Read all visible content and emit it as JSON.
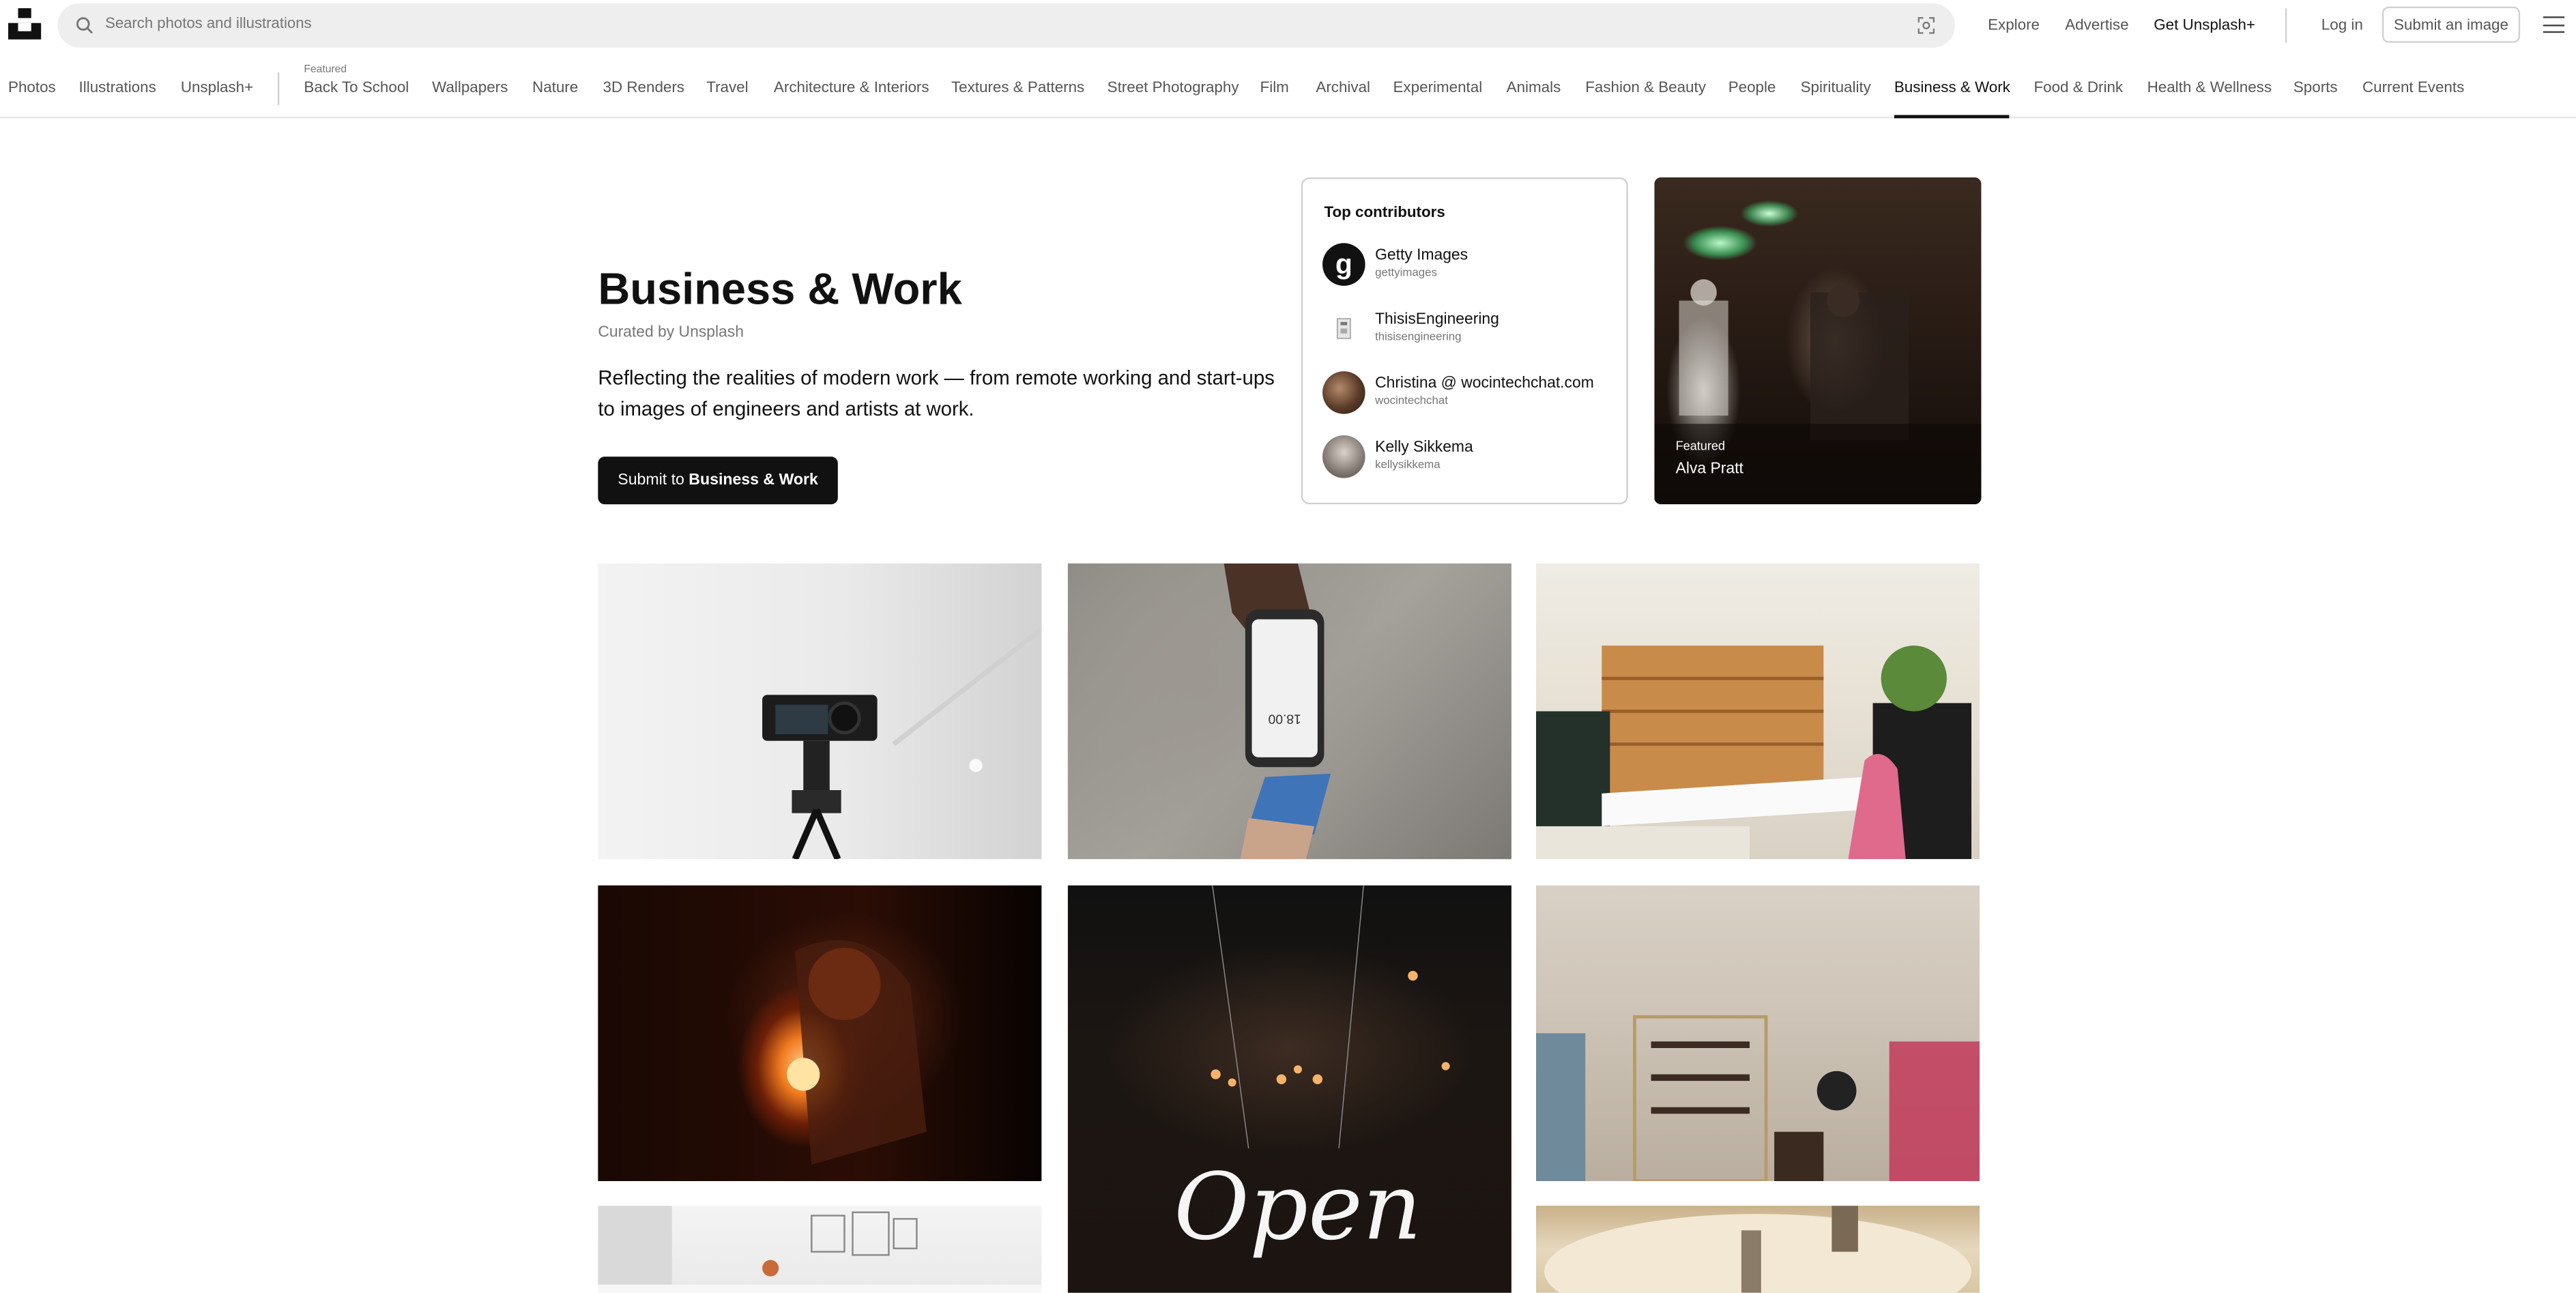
{
  "header": {
    "search_placeholder": "Search photos and illustrations",
    "links": {
      "explore": "Explore",
      "advertise": "Advertise",
      "get_plus": "Get Unsplash+",
      "login": "Log in",
      "submit_image": "Submit an image"
    }
  },
  "categories": {
    "items": [
      "Photos",
      "Illustrations",
      "Unsplash+",
      "Back To School",
      "Wallpapers",
      "Nature",
      "3D Renders",
      "Travel",
      "Architecture & Interiors",
      "Textures & Patterns",
      "Street Photography",
      "Film",
      "Archival",
      "Experimental",
      "Animals",
      "Fashion & Beauty",
      "People",
      "Spirituality",
      "Business & Work",
      "Food & Drink",
      "Health & Wellness",
      "Sports",
      "Current Events"
    ],
    "featured_label": "Featured",
    "active": "Business & Work"
  },
  "hero": {
    "title": "Business & Work",
    "curated": "Curated by Unsplash",
    "description": "Reflecting the realities of modern work — from remote working and start-ups to images of engineers and artists at work.",
    "submit_prefix": "Submit to",
    "submit_topic": "Business & Work"
  },
  "contributors": {
    "title": "Top contributors",
    "items": [
      {
        "name": "Getty Images",
        "username": "gettyimages"
      },
      {
        "name": "ThisisEngineering",
        "username": "thisisengineering"
      },
      {
        "name": "Christina @ wocintechchat.com",
        "username": "wocintechchat"
      },
      {
        "name": "Kelly Sikkema",
        "username": "kellysikkema"
      }
    ]
  },
  "featured_photo": {
    "label": "Featured",
    "name": "Alva Pratt"
  },
  "photos": {
    "open_sign": "Open",
    "phone_amount": "18.00"
  }
}
